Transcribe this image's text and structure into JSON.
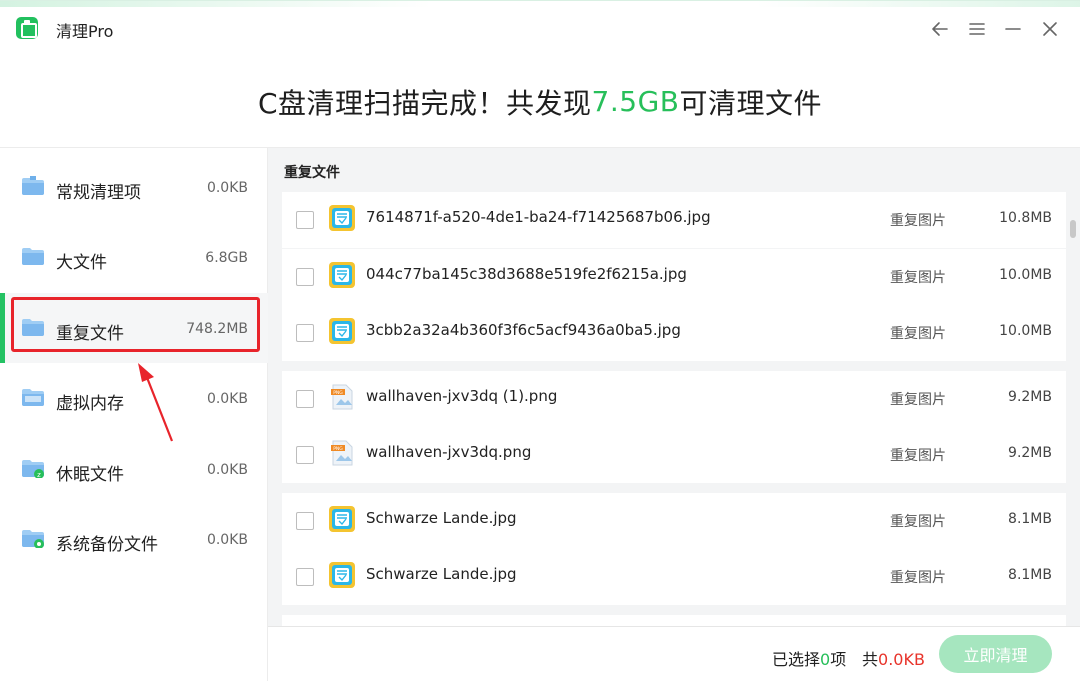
{
  "app": {
    "title": "清理Pro",
    "accent": "#27bf5a",
    "highlight": "#e8242b"
  },
  "window_controls": [
    {
      "name": "back-icon"
    },
    {
      "name": "menu-icon"
    },
    {
      "name": "minimize-icon"
    },
    {
      "name": "close-icon"
    }
  ],
  "headline": {
    "prefix": "C盘清理扫描完成！共发现",
    "size": "7.5GB",
    "suffix": "可清理文件"
  },
  "sidebar": {
    "items": [
      {
        "label": "常规清理项",
        "size": "0.0KB",
        "icon": "broom-folder-icon"
      },
      {
        "label": "大文件",
        "size": "6.8GB",
        "icon": "folder-icon"
      },
      {
        "label": "重复文件",
        "size": "748.2MB",
        "icon": "folder-icon",
        "active": true
      },
      {
        "label": "虚拟内存",
        "size": "0.0KB",
        "icon": "memory-folder-icon"
      },
      {
        "label": "休眠文件",
        "size": "0.0KB",
        "icon": "sleep-folder-icon"
      },
      {
        "label": "系统备份文件",
        "size": "0.0KB",
        "icon": "gear-folder-icon"
      }
    ]
  },
  "main": {
    "section_title": "重复文件",
    "groups": [
      {
        "files": [
          {
            "name": "7614871f-a520-4de1-ba24-f71425687b06.jpg",
            "type": "重复图片",
            "size": "10.8MB",
            "icon": "jpg-image-icon"
          }
        ]
      },
      {
        "files": [
          {
            "name": "044c77ba145c38d3688e519fe2f6215a.jpg",
            "type": "重复图片",
            "size": "10.0MB",
            "icon": "jpg-image-icon"
          },
          {
            "name": "3cbb2a32a4b360f3f6c5acf9436a0ba5.jpg",
            "type": "重复图片",
            "size": "10.0MB",
            "icon": "jpg-image-icon"
          }
        ]
      },
      {
        "files": [
          {
            "name": "wallhaven-jxv3dq (1).png",
            "type": "重复图片",
            "size": "9.2MB",
            "icon": "png-image-icon"
          },
          {
            "name": "wallhaven-jxv3dq.png",
            "type": "重复图片",
            "size": "9.2MB",
            "icon": "png-image-icon"
          }
        ]
      },
      {
        "files": [
          {
            "name": "Schwarze Lande.jpg",
            "type": "重复图片",
            "size": "8.1MB",
            "icon": "jpg-image-icon"
          },
          {
            "name": "Schwarze Lande.jpg",
            "type": "重复图片",
            "size": "8.1MB",
            "icon": "jpg-image-icon"
          }
        ]
      },
      {
        "files": [
          {
            "name": "",
            "type": "",
            "size": "",
            "icon": "jpg-image-icon"
          }
        ]
      }
    ]
  },
  "footer": {
    "selected_prefix": "已选择",
    "selected_count": "0",
    "selected_suffix": "项",
    "total_prefix": "共",
    "total_size": "0.0KB",
    "clean_button": "立即清理"
  }
}
